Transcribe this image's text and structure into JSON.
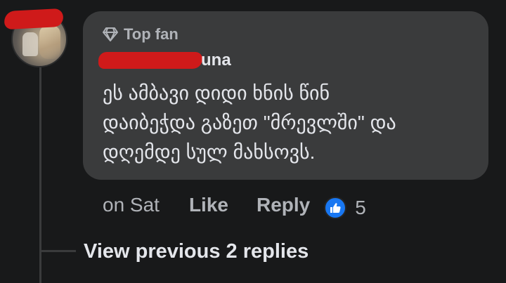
{
  "comment": {
    "badge_label": "Top fan",
    "badge_icon": "diamond-icon",
    "author_name_visible_suffix": "una",
    "text": "ეს ამბავი დიდი ხნის წინ\nდაიბეჭდა გაზეთ \"მრევლში\" და\nდღემდე სულ მახსოვს.",
    "timestamp": "on Sat",
    "like_label": "Like",
    "reply_label": "Reply",
    "reaction_icon": "thumbs-up-icon",
    "reaction_count": "5"
  },
  "thread": {
    "view_previous_label": "View previous 2 replies"
  },
  "colors": {
    "background": "#18191a",
    "bubble": "#3a3b3c",
    "primary_text": "#e4e6eb",
    "secondary_text": "#b0b3b8",
    "like_blue": "#1877f2",
    "redaction_red": "#cf1a1a"
  }
}
